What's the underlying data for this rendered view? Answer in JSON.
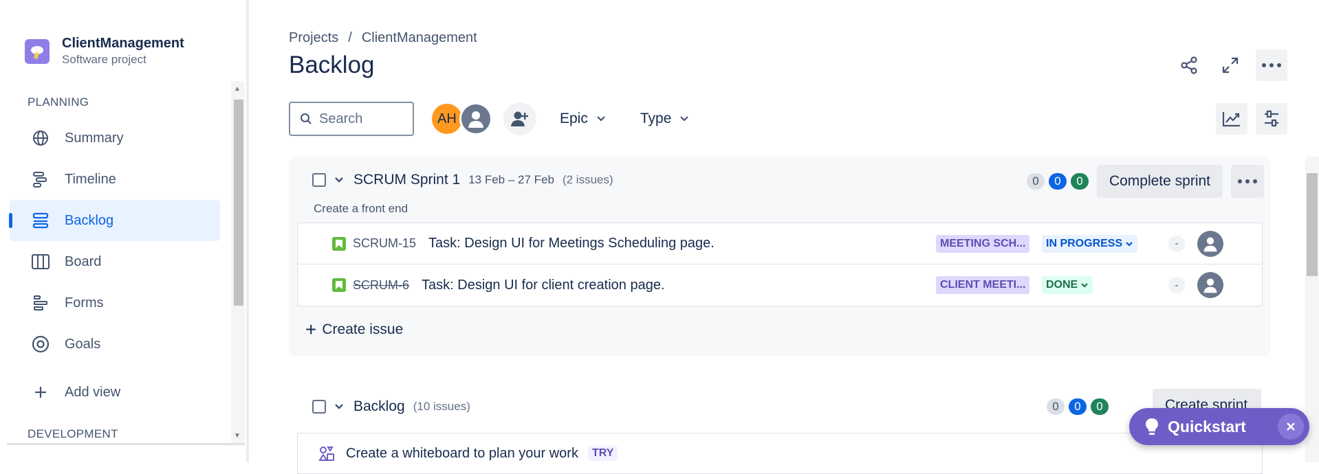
{
  "project": {
    "name": "ClientManagement",
    "type": "Software project"
  },
  "sidebar": {
    "sections": {
      "planning": "PLANNING",
      "development": "DEVELOPMENT"
    },
    "items": [
      {
        "label": "Summary",
        "icon": "globe-icon"
      },
      {
        "label": "Timeline",
        "icon": "timeline-icon"
      },
      {
        "label": "Backlog",
        "icon": "backlog-icon",
        "active": true
      },
      {
        "label": "Board",
        "icon": "board-icon"
      },
      {
        "label": "Forms",
        "icon": "forms-icon"
      },
      {
        "label": "Goals",
        "icon": "goals-icon"
      }
    ],
    "add_view": "Add view"
  },
  "breadcrumb": {
    "root": "Projects",
    "separator": "/",
    "current": "ClientManagement"
  },
  "page": {
    "title": "Backlog"
  },
  "toolbar": {
    "search_placeholder": "Search",
    "avatar_initials": "AH",
    "filters": {
      "epic": "Epic",
      "type": "Type"
    }
  },
  "sprint": {
    "name": "SCRUM Sprint 1",
    "dates": "13 Feb – 27 Feb",
    "issue_count": "(2 issues)",
    "goal": "Create a front end",
    "counts": {
      "todo": "0",
      "in_progress": "0",
      "done": "0"
    },
    "complete_label": "Complete sprint",
    "create_issue": "Create issue",
    "issues": [
      {
        "key": "SCRUM-15",
        "summary": "Task: Design UI for Meetings Scheduling page.",
        "epic": "MEETING SCH...",
        "status": "IN PROGRESS",
        "estimate": "-"
      },
      {
        "key": "SCRUM-6",
        "summary": "Task: Design UI for client creation page.",
        "epic": "CLIENT MEETI...",
        "status": "DONE",
        "estimate": "-"
      }
    ]
  },
  "backlog": {
    "name": "Backlog",
    "issue_count": "(10 issues)",
    "counts": {
      "todo": "0",
      "in_progress": "0",
      "done": "0"
    },
    "create_sprint": "Create sprint",
    "whiteboard_text": "Create a whiteboard to plan your work",
    "try_label": "TRY"
  },
  "quickstart": {
    "label": "Quickstart"
  },
  "colors": {
    "accent": "#0c66e4",
    "quickstart": "#6e5dc6",
    "story": "#63ba3c"
  }
}
